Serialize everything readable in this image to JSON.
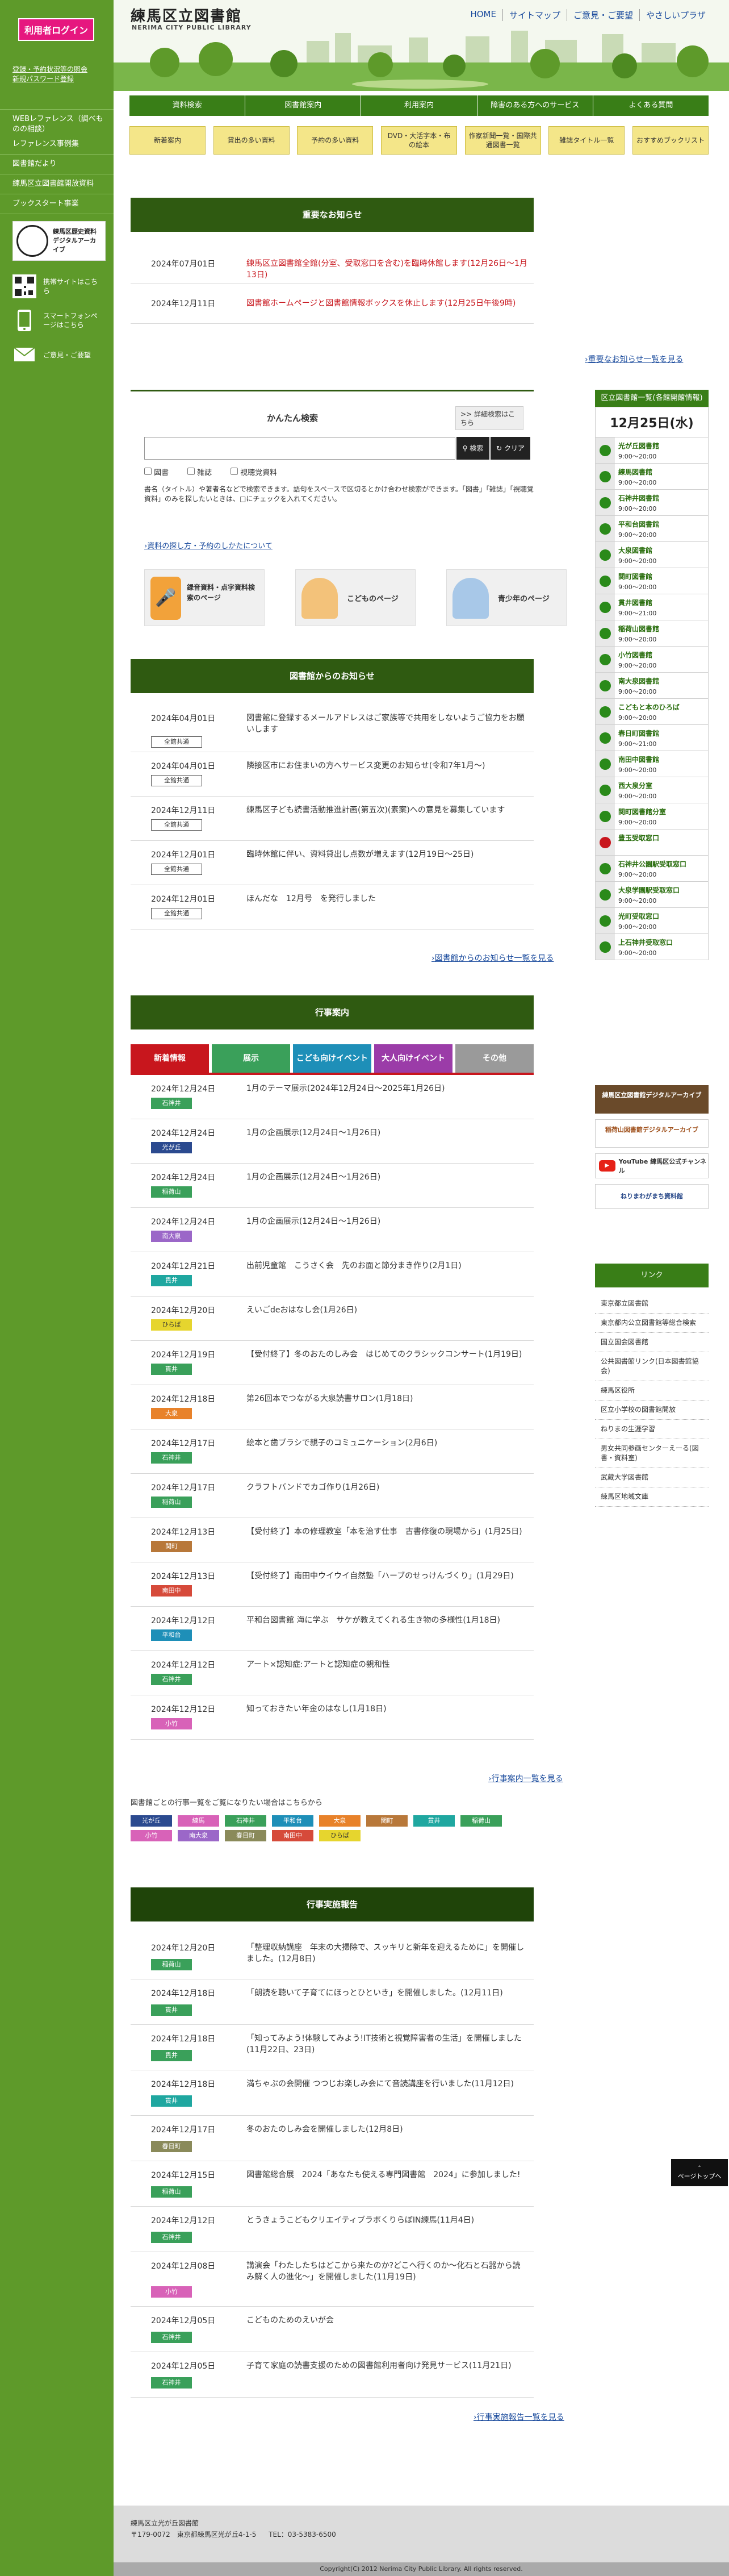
{
  "sidebar": {
    "login_label": "利用者ログイン",
    "small_links": [
      "登録・予約状況等の照会",
      "新規パスワード登録"
    ],
    "menu": [
      "WEBレファレンス（調べものの相談）",
      "レファレンス事例集",
      "図書館だより",
      "練馬区立図書館開放資料",
      "ブックスタート事業"
    ],
    "archive_banner": "練馬区歴史資料デジタルアーカイブ",
    "mobile_label": "携帯サイトはこちら",
    "smartphone_label": "スマートフォンページはこちら",
    "opinion_label": "ご意見・ご要望"
  },
  "header": {
    "title": "練馬区立図書館",
    "subtitle": "NERIMA CITY PUBLIC LIBRARY",
    "top_links": [
      "HOME",
      "サイトマップ",
      "ご意見・ご要望",
      "やさしいプラザ"
    ]
  },
  "nav_main": [
    "資料検索",
    "図書館案内",
    "利用案内",
    "障害のある方へのサービス",
    "よくある質問"
  ],
  "nav_sub": [
    "新着案内",
    "貸出の多い資料",
    "予約の多い資料",
    "DVD・大活字本・布の絵本",
    "作家新聞一覧・国際共通図書一覧",
    "雑誌タイトル一覧",
    "おすすめブックリスト"
  ],
  "important": {
    "heading": "重要なお知らせ",
    "items": [
      {
        "date": "2024年07月01日",
        "text": "練馬区立図書館全館(分室、受取窓口を含む)を臨時休館します(12月26日〜1月13日)"
      },
      {
        "date": "2024年12月11日",
        "text": "図書館ホームページと図書館情報ボックスを休止します(12月25日午後9時)"
      }
    ],
    "more": "重要なお知らせ一覧を見る"
  },
  "search": {
    "title": "かんたん検索",
    "detail_label": "詳細検索はこちら",
    "search_btn": "検索",
    "clear_btn": "クリア",
    "options": [
      "図書",
      "雑誌",
      "視聴覚資料"
    ],
    "help": "書名（タイトル）や著者名などで検索できます。語句をスペースで区切るとかけ合わせ検索ができます。「図書」「雑誌」「視聴覚資料」のみを探したいときは、□にチェックを入れてください。",
    "help_link": "資料の探し方・予約のしかたについて",
    "quick": [
      "録音資料・点字資料検索のページ",
      "こどものページ",
      "青少年のページ"
    ]
  },
  "notices": {
    "heading": "図書館からのお知らせ",
    "items": [
      {
        "date": "2024年04月01日",
        "text": "図書館に登録するメールアドレスはご家族等で共用をしないようご協力をお願いします",
        "tag": "全館共通"
      },
      {
        "date": "2024年04月01日",
        "text": "隣接区市にお住まいの方へサービス変更のお知らせ(令和7年1月〜)",
        "tag": "全館共通"
      },
      {
        "date": "2024年12月11日",
        "text": "練馬区子ども読書活動推進計画(第五次)(素案)への意見を募集しています",
        "tag": "全館共通"
      },
      {
        "date": "2024年12月01日",
        "text": "臨時休館に伴い、資料貸出し点数が増えます(12月19日〜25日)",
        "tag": "全館共通"
      },
      {
        "date": "2024年12月01日",
        "text": "ほんだな　12月号　を発行しました",
        "tag": "全館共通"
      }
    ],
    "more": "図書館からのお知らせ一覧を見る"
  },
  "events": {
    "heading": "行事案内",
    "tabs": [
      {
        "label": "新着情報",
        "color": "#c8161d"
      },
      {
        "label": "展示",
        "color": "#3aa05a"
      },
      {
        "label": "こども向けイベント",
        "color": "#1e8fb8"
      },
      {
        "label": "大人向けイベント",
        "color": "#9b3ca8"
      },
      {
        "label": "その他",
        "color": "#9a9a9a"
      }
    ],
    "items": [
      {
        "date": "2024年12月24日",
        "text": "1月のテーマ展示(2024年12月24日〜2025年1月26日)",
        "tag": "石神井",
        "color": "#3aa05a"
      },
      {
        "date": "2024年12月24日",
        "text": "1月の企画展示(12月24日〜1月26日)",
        "tag": "光が丘",
        "color": "#2b4a8f"
      },
      {
        "date": "2024年12月24日",
        "text": "1月の企画展示(12月24日〜1月26日)",
        "tag": "稲荷山",
        "color": "#3aa05a"
      },
      {
        "date": "2024年12月24日",
        "text": "1月の企画展示(12月24日〜1月26日)",
        "tag": "南大泉",
        "color": "#9b67c8"
      },
      {
        "date": "2024年12月21日",
        "text": "出前児童館　こうさく会　先のお面と節分まき作り(2月1日)",
        "tag": "貫井",
        "color": "#1fa7a0"
      },
      {
        "date": "2024年12月20日",
        "text": "えいごdeおはなし会(1月26日)",
        "tag": "ひらば",
        "color": "#e6d52e"
      },
      {
        "date": "2024年12月19日",
        "text": "【受付終了】冬のおたのしみ会　はじめてのクラシックコンサート(1月19日)",
        "tag": "貫井",
        "color": "#3aa05a"
      },
      {
        "date": "2024年12月18日",
        "text": "第26回本でつながる大泉読書サロン(1月18日)",
        "tag": "大泉",
        "color": "#e8822a"
      },
      {
        "date": "2024年12月17日",
        "text": "絵本と歯ブラシで親子のコミュニケーション(2月6日)",
        "tag": "石神井",
        "color": "#3aa05a"
      },
      {
        "date": "2024年12月17日",
        "text": "クラフトバンドでカゴ作り(1月26日)",
        "tag": "稲荷山",
        "color": "#3aa05a"
      },
      {
        "date": "2024年12月13日",
        "text": "【受付終了】本の修理教室「本を治す仕事　古書修復の現場から」(1月25日)",
        "tag": "関町",
        "color": "#b8783a"
      },
      {
        "date": "2024年12月13日",
        "text": "【受付終了】南田中ウイウイ自然塾「ハーブのせっけんづくり」(1月29日)",
        "tag": "南田中",
        "color": "#d64a3a"
      },
      {
        "date": "2024年12月12日",
        "text": "平和台図書館 海に学ぶ　サケが教えてくれる生き物の多様性(1月18日)",
        "tag": "平和台",
        "color": "#1e8fb8"
      },
      {
        "date": "2024年12月12日",
        "text": "アート×認知症:アートと認知症の親和性",
        "tag": "石神井",
        "color": "#3aa05a"
      },
      {
        "date": "2024年12月12日",
        "text": "知っておきたい年金のはなし(1月18日)",
        "tag": "小竹",
        "color": "#d862b8"
      }
    ],
    "more": "行事案内一覧を見る",
    "per_lib_note": "図書館ごとの行事一覧をご覧になりたい場合はこちらから",
    "lib_tags": [
      {
        "name": "光が丘",
        "color": "#2b4a8f"
      },
      {
        "name": "練馬",
        "color": "#d862b8"
      },
      {
        "name": "石神井",
        "color": "#3aa05a"
      },
      {
        "name": "平和台",
        "color": "#1e8fb8"
      },
      {
        "name": "大泉",
        "color": "#e8822a"
      },
      {
        "name": "関町",
        "color": "#b8783a"
      },
      {
        "name": "貫井",
        "color": "#1fa7a0"
      },
      {
        "name": "稲荷山",
        "color": "#3aa05a"
      },
      {
        "name": "小竹",
        "color": "#d862b8"
      },
      {
        "name": "南大泉",
        "color": "#9b67c8"
      },
      {
        "name": "春日町",
        "color": "#8a8a5a"
      },
      {
        "name": "南田中",
        "color": "#d64a3a"
      },
      {
        "name": "ひらば",
        "color": "#e6d52e"
      }
    ]
  },
  "reports": {
    "heading": "行事実施報告",
    "items": [
      {
        "date": "2024年12月20日",
        "text": "「整理収納講座　年末の大掃除で、スッキリと新年を迎えるために」を開催しました。(12月8日)",
        "tag": "稲荷山",
        "color": "#3aa05a"
      },
      {
        "date": "2024年12月18日",
        "text": "「朗読を聴いて子育てにほっとひといき」を開催しました。(12月11日)",
        "tag": "貫井",
        "color": "#3aa05a"
      },
      {
        "date": "2024年12月18日",
        "text": "「知ってみよう!体験してみよう!IT技術と視覚障害者の生活」を開催しました(11月22日、23日)",
        "tag": "貫井",
        "color": "#3aa05a"
      },
      {
        "date": "2024年12月18日",
        "text": "満ちゃぶの会開催 つつじお楽しみ会にて音読講座を行いました(11月12日)",
        "tag": "貫井",
        "color": "#1fa7a0"
      },
      {
        "date": "2024年12月17日",
        "text": "冬のおたのしみ会を開催しました(12月8日)",
        "tag": "春日町",
        "color": "#8a8a5a"
      },
      {
        "date": "2024年12月15日",
        "text": "図書館総合展　2024「あなたも使える専門図書館　2024」に参加しました!",
        "tag": "稲荷山",
        "color": "#3aa05a"
      },
      {
        "date": "2024年12月12日",
        "text": "とうきょうこどもクリエイティブラボくりらぼIN練馬(11月4日)",
        "tag": "石神井",
        "color": "#3aa05a"
      },
      {
        "date": "2024年12月08日",
        "text": "講演会「わたしたちはどこから来たのか?どこへ行くのか〜化石と石器から読み解く人の進化〜」を開催しました(11月19日)",
        "tag": "小竹",
        "color": "#d862b8"
      },
      {
        "date": "2024年12月05日",
        "text": "こどものためのえいが会",
        "tag": "石神井",
        "color": "#3aa05a"
      },
      {
        "date": "2024年12月05日",
        "text": "子育て家庭の読書支援のための図書館利用者向け発見サービス(11月21日)",
        "tag": "石神井",
        "color": "#3aa05a"
      }
    ],
    "more": "行事実施報告一覧を見る"
  },
  "calendar": {
    "title": "区立図書館一覧(各館開館情報)",
    "date": "12月25日(水)",
    "libraries": [
      {
        "name": "光が丘図書館",
        "hours": "9:00〜20:00"
      },
      {
        "name": "練馬図書館",
        "hours": "9:00〜20:00"
      },
      {
        "name": "石神井図書館",
        "hours": "9:00〜20:00"
      },
      {
        "name": "平和台図書館",
        "hours": "9:00〜20:00"
      },
      {
        "name": "大泉図書館",
        "hours": "9:00〜20:00"
      },
      {
        "name": "関町図書館",
        "hours": "9:00〜20:00"
      },
      {
        "name": "貫井図書館",
        "hours": "9:00〜21:00"
      },
      {
        "name": "稲荷山図書館",
        "hours": "9:00〜20:00"
      },
      {
        "name": "小竹図書館",
        "hours": "9:00〜20:00"
      },
      {
        "name": "南大泉図書館",
        "hours": "9:00〜20:00"
      },
      {
        "name": "こどもと本のひろば",
        "hours": "9:00〜20:00"
      },
      {
        "name": "春日町図書館",
        "hours": "9:00〜21:00"
      },
      {
        "name": "南田中図書館",
        "hours": "9:00〜20:00"
      },
      {
        "name": "西大泉分室",
        "hours": "9:00〜20:00"
      },
      {
        "name": "関町図書館分室",
        "hours": "9:00〜20:00"
      },
      {
        "name": "豊玉受取窓口",
        "hours": ""
      },
      {
        "name": "石神井公園駅受取窓口",
        "hours": "9:00〜20:00"
      },
      {
        "name": "大泉学園駅受取窓口",
        "hours": "9:00〜20:00"
      },
      {
        "name": "光町受取窓口",
        "hours": "9:00〜20:00"
      },
      {
        "name": "上石神井受取窓口",
        "hours": "9:00〜20:00"
      }
    ]
  },
  "banners": [
    "練馬区立図書館デジタルアーカイブ",
    "稲荷山図書館デジタルアーカイブ",
    "YouTube 練馬区公式チャンネル",
    "ねりまわがまち資料館"
  ],
  "links": {
    "heading": "リンク",
    "items": [
      "東京都立図書館",
      "東京都内公立図書館等総合検索",
      "国立国会図書館",
      "公共図書館リンク(日本図書館協会)",
      "練馬区役所",
      "区立小学校の図書館開放",
      "ねりまの生涯学習",
      "男女共同参画センターえーる(図書・資料室)",
      "武蔵大学図書館",
      "練馬区地域文庫"
    ]
  },
  "pagetop": "ページトップへ",
  "footer": {
    "name": "練馬区立光が丘図書館",
    "address": "〒179-0072　東京都練馬区光が丘4-1-5",
    "tel": "TEL：03-5383-6500",
    "copyright": "Copyright(C) 2012 Nerima City Public Library. All rights reserved."
  }
}
